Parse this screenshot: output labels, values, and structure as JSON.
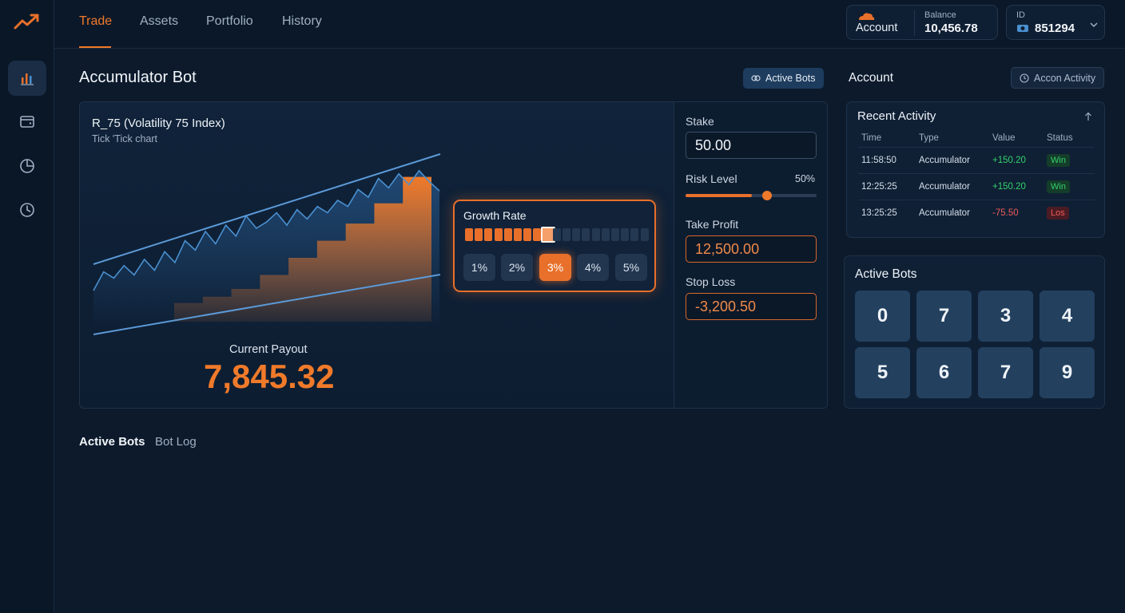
{
  "nav": {
    "tabs": [
      {
        "label": "Trade",
        "active": true
      },
      {
        "label": "Assets"
      },
      {
        "label": "Portfolio"
      },
      {
        "label": "History"
      }
    ]
  },
  "header": {
    "account_label": "Account",
    "balance_label": "Balance",
    "balance_value": "10,456.78",
    "id_label": "ID",
    "id_value": "851294"
  },
  "page": {
    "title": "Accumulator Bot",
    "active_bots_button": "Active Bots"
  },
  "chart": {
    "symbol": "R_75 (Volatility 75 Index)",
    "subtitle": "Tick 'Tick chart",
    "payout_label": "Current Payout",
    "payout_value": "7,845.32"
  },
  "chart_data": {
    "type": "line",
    "title": "R_75 (Volatility 75 Index)",
    "series": [
      {
        "values": [
          0.2,
          0.32,
          0.28,
          0.36,
          0.3,
          0.4,
          0.33,
          0.45,
          0.38,
          0.52,
          0.46,
          0.58,
          0.5,
          0.62,
          0.55,
          0.68,
          0.6,
          0.64,
          0.7,
          0.62,
          0.72,
          0.66,
          0.74,
          0.7,
          0.78,
          0.74,
          0.85,
          0.8,
          0.92,
          0.86,
          0.95,
          0.88,
          0.97,
          0.9,
          0.84
        ]
      },
      {
        "values": [
          0.12,
          0.12,
          0.16,
          0.16,
          0.21,
          0.21,
          0.3,
          0.3,
          0.41,
          0.41,
          0.52,
          0.52,
          0.63,
          0.63,
          0.76,
          0.76,
          0.93,
          0.93
        ]
      }
    ]
  },
  "growth": {
    "label": "Growth Rate",
    "level": 0.47,
    "rates": [
      "1%",
      "2%",
      "3%",
      "4%",
      "5%"
    ],
    "selected": "3%"
  },
  "settings": {
    "stake_label": "Stake",
    "stake_value": "50.00",
    "risk_label": "Risk Level",
    "risk_value": "50%",
    "risk_level": 0.5,
    "take_profit_label": "Take Profit",
    "take_profit_value": "12,500.00",
    "stop_loss_label": "Stop Loss",
    "stop_loss_value": "-3,200.50"
  },
  "account_panel": {
    "title": "Account",
    "activity_button": "Accon Activity"
  },
  "recent": {
    "title": "Recent Activity",
    "columns": [
      "Time",
      "Type",
      "Value",
      "Status"
    ],
    "rows": [
      {
        "time": "11:58:50",
        "type": "Accumulator",
        "value": "+150.20",
        "status": "Win"
      },
      {
        "time": "12:25:25",
        "type": "Accumulator",
        "value": "+150.20",
        "status": "Win"
      },
      {
        "time": "13:25:25",
        "type": "Accumulator",
        "value": "-75.50",
        "status": "Los"
      }
    ]
  },
  "active_bots": {
    "title": "Active Bots",
    "numbers": [
      "0",
      "7",
      "3",
      "4",
      "5",
      "6",
      "7",
      "9"
    ]
  },
  "bottom_tabs": {
    "active": "Active Bots",
    "log": "Bot Log"
  },
  "colors": {
    "accent": "#e8702a",
    "win": "#34d16a",
    "loss": "#ef5a5a",
    "line": "#4a90d0"
  }
}
